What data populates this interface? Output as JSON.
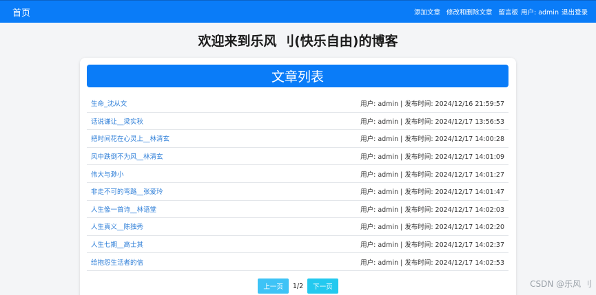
{
  "navbar": {
    "home": "首页",
    "links": [
      "添加文章",
      "修改和删除文章",
      "留言板"
    ],
    "user_label": "用户: admin",
    "logout": "退出登录"
  },
  "page_title": "欢迎来到乐风 刂(快乐自由)的博客",
  "card_title": "文章列表",
  "articles": [
    {
      "title": "生命_沈从文",
      "meta": "用户: admin | 发布时间: 2024/12/16 21:59:57"
    },
    {
      "title": "话说谦让__梁实秋",
      "meta": "用户: admin | 发布时间: 2024/12/17 13:56:53"
    },
    {
      "title": "把时间花在心灵上__林清玄",
      "meta": "用户: admin | 发布时间: 2024/12/17 14:00:28"
    },
    {
      "title": "风中跌倒不为风__林清玄",
      "meta": "用户: admin | 发布时间: 2024/12/17 14:01:09"
    },
    {
      "title": "伟大与渺小",
      "meta": "用户: admin | 发布时间: 2024/12/17 14:01:27"
    },
    {
      "title": "非走不可的弯路__张爱玲",
      "meta": "用户: admin | 发布时间: 2024/12/17 14:01:47"
    },
    {
      "title": "人生像一首诗__林语堂",
      "meta": "用户: admin | 发布时间: 2024/12/17 14:02:03"
    },
    {
      "title": "人生真义__陈独秀",
      "meta": "用户: admin | 发布时间: 2024/12/17 14:02:20"
    },
    {
      "title": "人生七期__高士其",
      "meta": "用户: admin | 发布时间: 2024/12/17 14:02:37"
    },
    {
      "title": "给抱怨生活者的信",
      "meta": "用户: admin | 发布时间: 2024/12/17 14:02:53"
    }
  ],
  "pager": {
    "prev": "上一页",
    "info": "1/2",
    "next": "下一页"
  },
  "watermark": "CSDN @乐风 刂"
}
